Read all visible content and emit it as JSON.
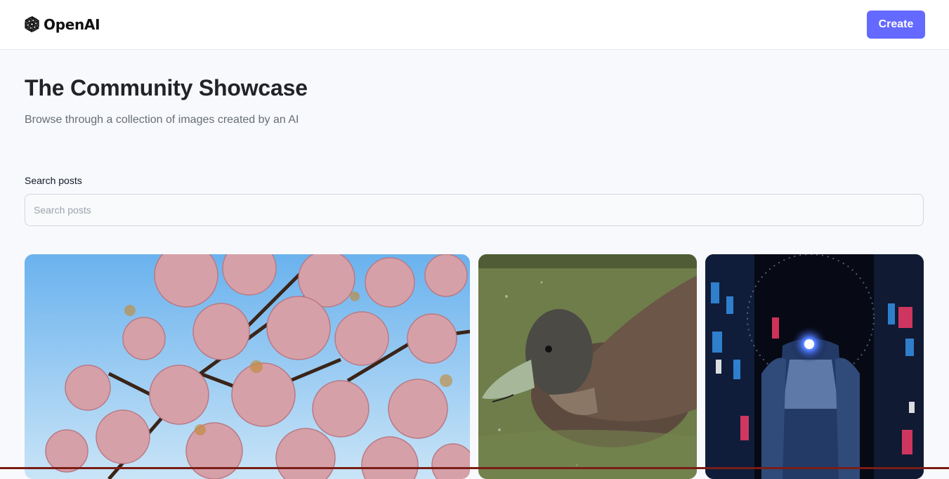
{
  "header": {
    "logo_text": "OpenAI",
    "logo_icon": "openai-logo-icon",
    "create_label": "Create"
  },
  "main": {
    "title": "The Community Showcase",
    "subtitle": "Browse through a collection of images created by an AI"
  },
  "search": {
    "label": "Search posts",
    "placeholder": "Search posts",
    "value": ""
  },
  "gallery": {
    "cards": [
      {
        "subject": "cherry blossom tree against blue sky"
      },
      {
        "subject": "duck swimming in green water"
      },
      {
        "subject": "robot in neon-lit city at night"
      }
    ]
  },
  "colors": {
    "accent": "#6469ff",
    "title": "#222328",
    "subtitle": "#666e75",
    "background": "#f8f9fc"
  }
}
